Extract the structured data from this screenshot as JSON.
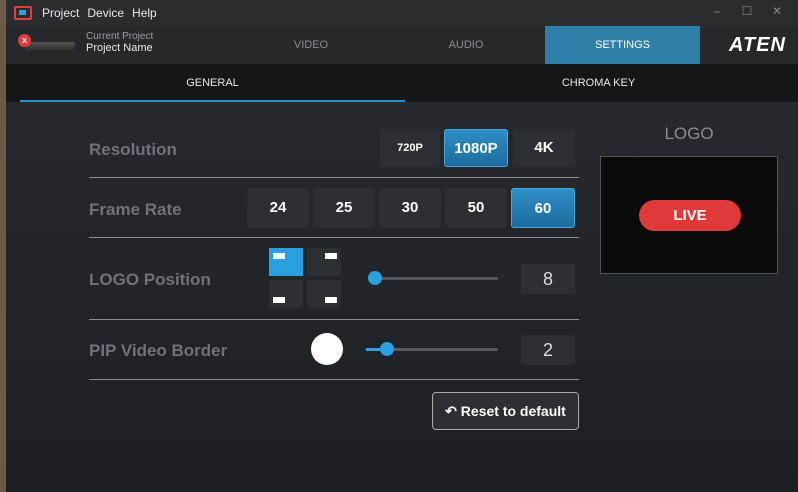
{
  "menu": [
    "Project",
    "Device",
    "Help"
  ],
  "window_controls": [
    "–",
    "☐",
    "✕"
  ],
  "header": {
    "project_caption": "Current Project",
    "project_name": "Project Name",
    "tabs": [
      "VIDEO",
      "AUDIO",
      "SETTINGS"
    ],
    "brand": "ATEN"
  },
  "subtabs": [
    "GENERAL",
    "CHROMA KEY"
  ],
  "settings": {
    "resolution_label": "Resolution",
    "resolution_options": [
      "720P",
      "1080P",
      "4K"
    ],
    "resolution_selected": "1080P",
    "frame_rate_label": "Frame Rate",
    "frame_rate_options": [
      "24",
      "25",
      "30",
      "50",
      "60"
    ],
    "frame_rate_selected": "60",
    "logo_position_label": "LOGO Position",
    "logo_position_value": "8",
    "pip_border_label": "PIP Video Border",
    "pip_border_value": "2",
    "reset_label": "Reset to default"
  },
  "logo_panel": {
    "title": "LOGO",
    "live_badge": "LIVE"
  },
  "colors": {
    "accent": "#2aa0e0",
    "live": "#e0393a"
  }
}
